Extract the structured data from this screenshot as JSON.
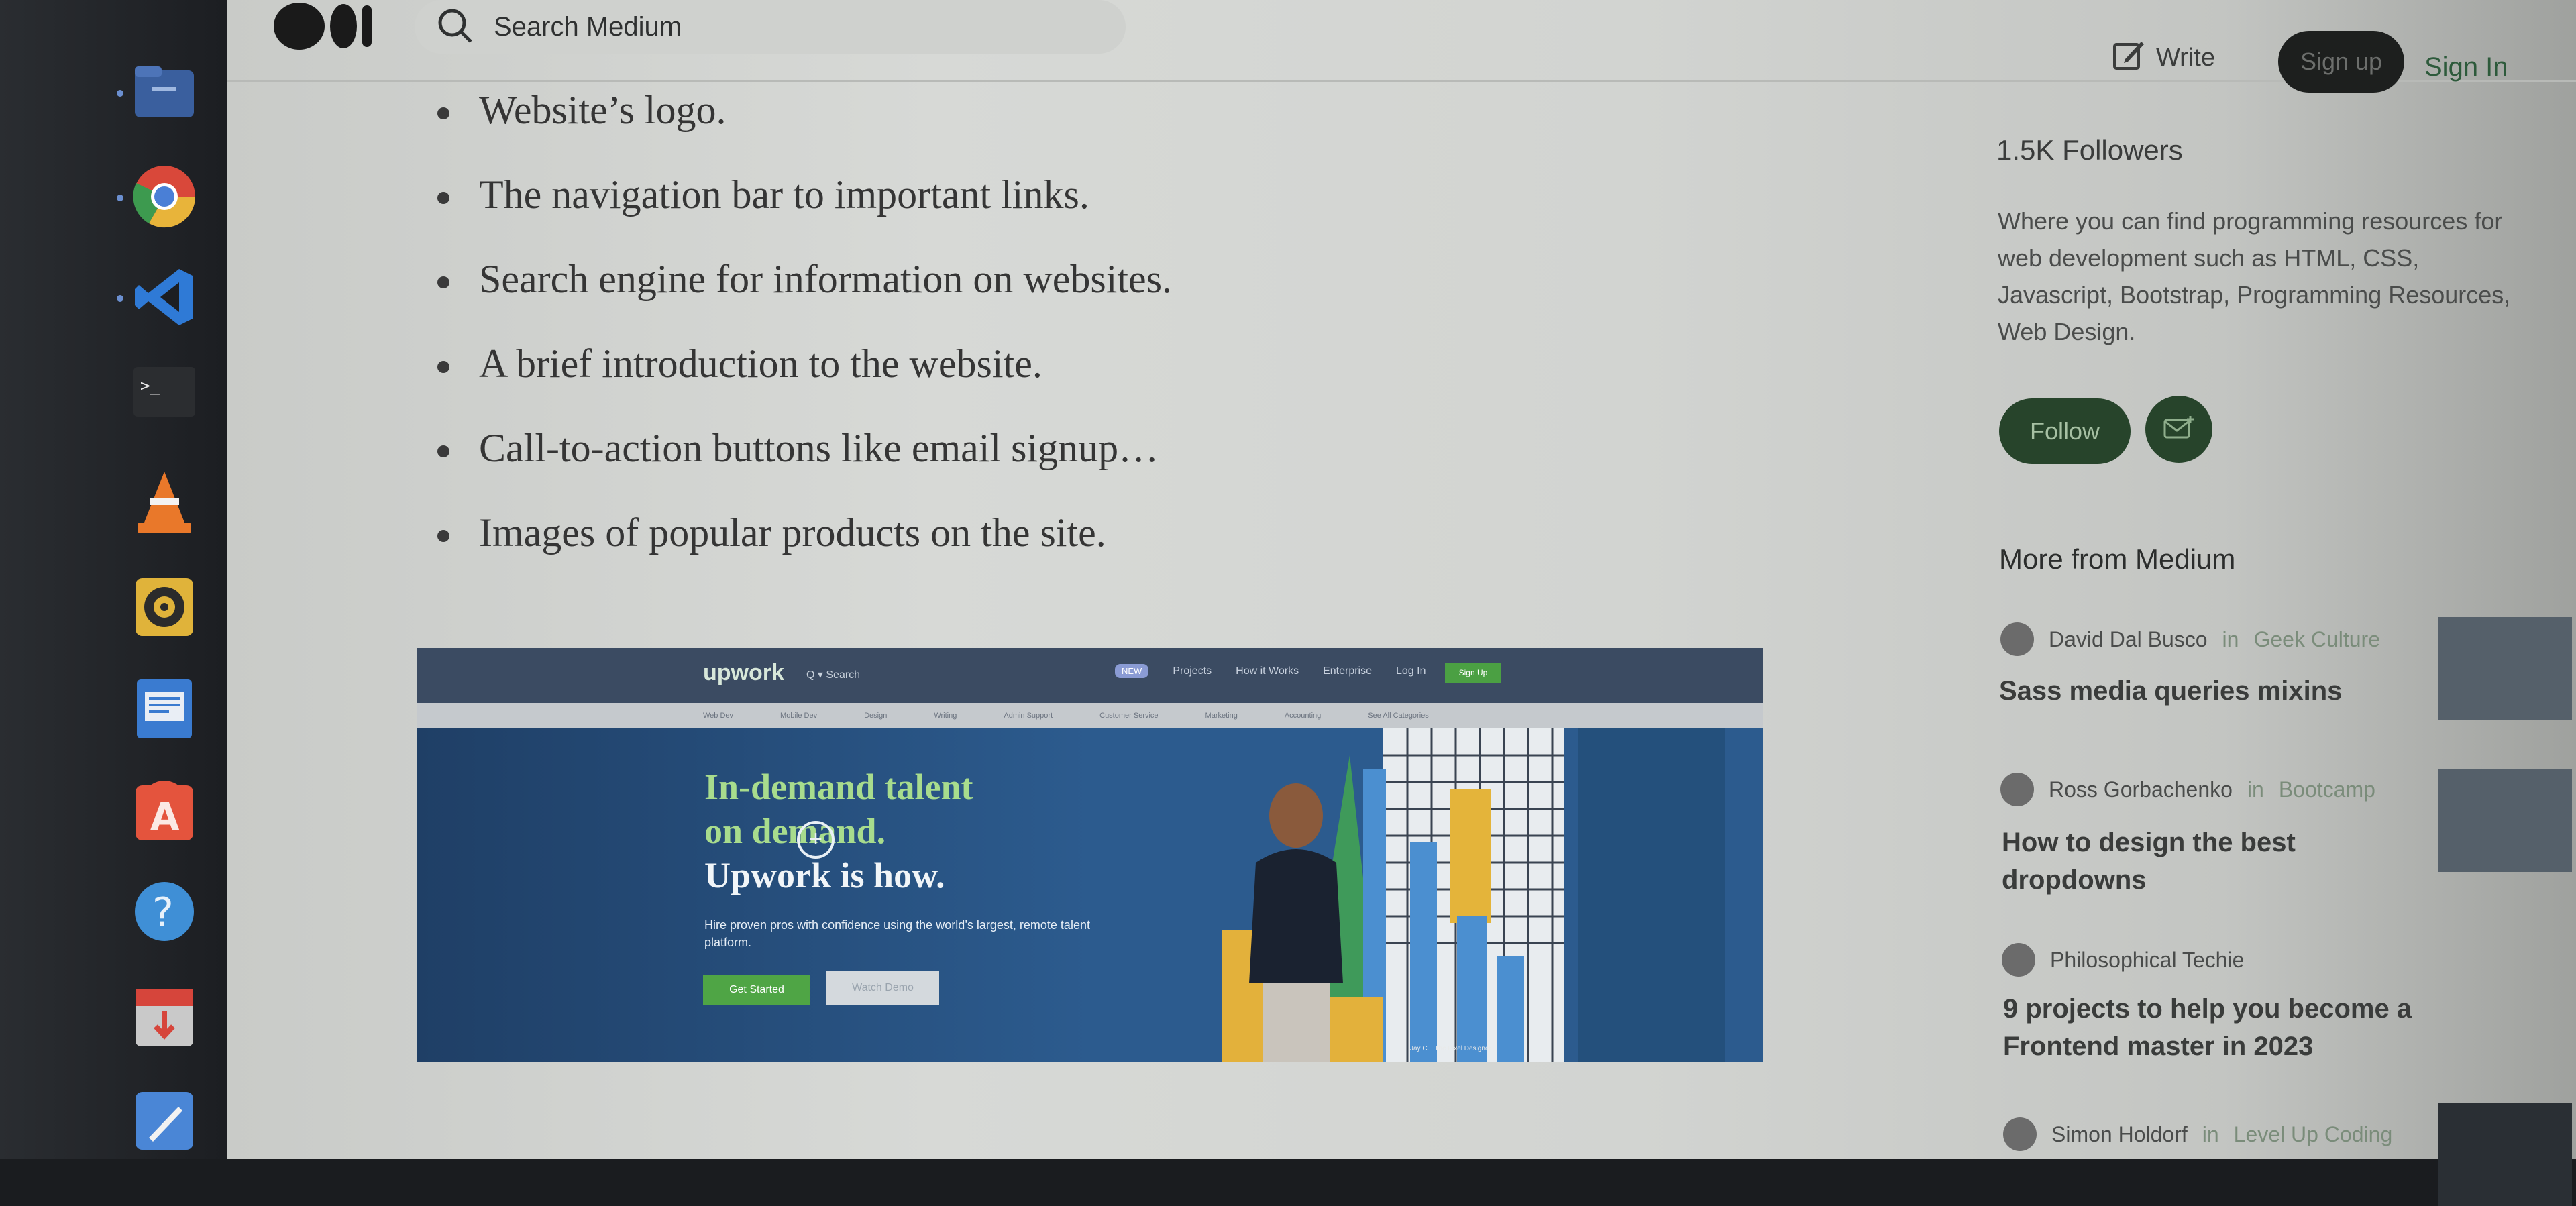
{
  "dock": {
    "apps": [
      "files-icon",
      "chrome-icon",
      "vscode-icon",
      "terminal-icon",
      "vlc-icon",
      "rhythmbox-icon",
      "text-editor-icon",
      "software-center-icon",
      "help-icon",
      "installer-icon",
      "pen-icon"
    ]
  },
  "header": {
    "search_placeholder": "Search Medium",
    "write_label": "Write",
    "signup_label": "Sign up",
    "signin_label": "Sign In"
  },
  "article": {
    "bullets": [
      "Website’s logo.",
      "The navigation bar to important links.",
      "Search engine for information on websites.",
      "A brief introduction to the website.",
      "Call-to-action buttons like email signup…",
      "Images of popular products on the site."
    ],
    "image": {
      "brand": "upwork",
      "search": "Q ▾  Search",
      "nav": [
        "NEW",
        "Projects",
        "How it Works",
        "Enterprise",
        "Log In"
      ],
      "signup": "Sign Up",
      "categories": [
        "Web Dev",
        "Mobile Dev",
        "Design",
        "Writing",
        "Admin Support",
        "Customer Service",
        "Marketing",
        "Accounting",
        "See All Categories"
      ],
      "headline": [
        "In-demand talent",
        "on demand.",
        "Upwork is how."
      ],
      "subtext": "Hire proven pros with confidence using the world’s largest, remote talent platform.",
      "btn_primary": "Get Started",
      "btn_secondary": "Watch Demo",
      "caption": "Jay C. | The Pixel Designer"
    }
  },
  "sidebar": {
    "followers": "1.5K Followers",
    "bio": "Where you can find programming resources for web development such as HTML, CSS, Javascript, Bootstrap, Programming Resources, Web Design.",
    "follow_label": "Follow",
    "more_title": "More from Medium",
    "stories": [
      {
        "author": "David Dal Busco",
        "sep": "in",
        "publication": "Geek Culture",
        "title": "Sass media queries mixins"
      },
      {
        "author": "Ross Gorbachenko",
        "sep": "in",
        "publication": "Bootcamp",
        "title": "How to design the best dropdowns"
      },
      {
        "author": "Philosophical Techie",
        "sep": "",
        "publication": "",
        "title": "9 projects to help you become a Frontend master in 2023"
      },
      {
        "author": "Simon Holdorf",
        "sep": "in",
        "publication": "Level Up Coding",
        "title": ""
      }
    ]
  }
}
